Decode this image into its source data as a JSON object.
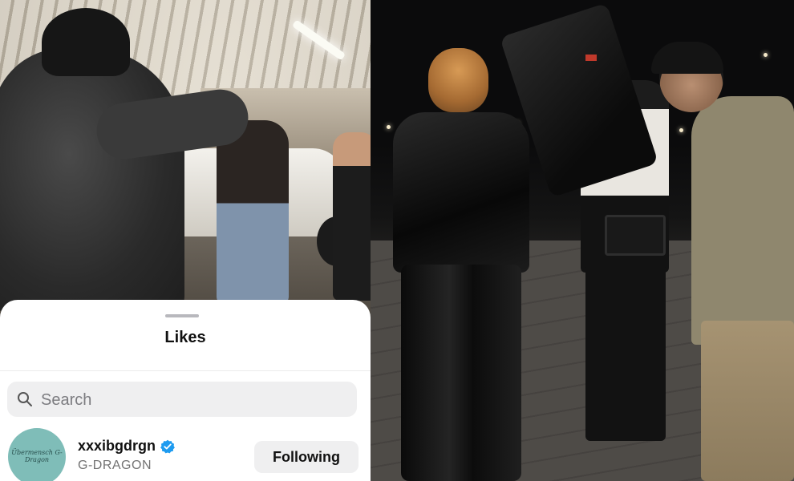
{
  "likes_sheet": {
    "title": "Likes",
    "search": {
      "placeholder": "Search",
      "value": ""
    },
    "users": [
      {
        "username": "xxxibgdrgn",
        "display_name": "G-DRAGON",
        "verified": true,
        "follow_button_label": "Following",
        "avatar_text": "Übermensch G-Dragon"
      }
    ]
  },
  "colors": {
    "verified_badge": "#1d9bf0",
    "button_bg": "#efeff0",
    "avatar_bg": "#7fbdb8"
  },
  "icons": {
    "search": "search-icon",
    "verified": "verified-badge-icon"
  }
}
